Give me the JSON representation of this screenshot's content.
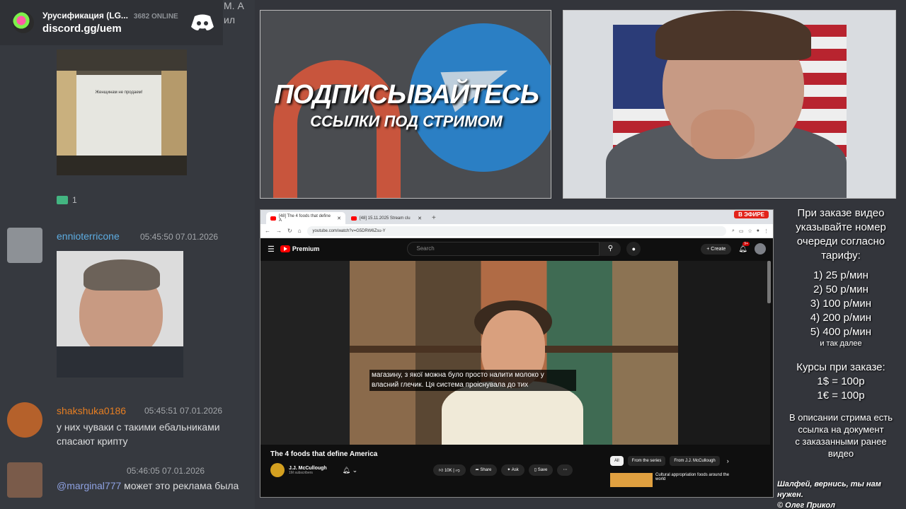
{
  "discord_widget": {
    "server_name": "Урусификация (LG...",
    "online": "3682 ONLINE",
    "invite": "discord.gg/uem"
  },
  "clipped_text": {
    "line1": "М. А",
    "line2": "ил"
  },
  "chat": {
    "attachment1_sign": "Женщинам не продаем!",
    "reaction_count": "1",
    "messages": [
      {
        "user": "ennioterricone",
        "user_color": "#5dade2",
        "time": "05:45:50 07.01.2026",
        "text": ""
      },
      {
        "user": "shakshuka0186",
        "user_color": "#e67e22",
        "time": "05:45:51 07.01.2026",
        "text": "у них чуваки с такими ебальниками спасают крипту"
      },
      {
        "user": "",
        "user_color": "#2ecc71",
        "time": "05:46:05 07.01.2026",
        "mention": "@marginal777",
        "text": " может это реклама была"
      }
    ]
  },
  "promo": {
    "title": "ПОДПИСЫВАЙТЕСЬ",
    "subtitle": "ССЫЛКИ ПОД СТРИМОМ"
  },
  "browser": {
    "tabs": [
      "[48] The 4 foods that define A",
      "[48] 15.11.2025 Stream clu"
    ],
    "live_badge": "В ЭФИРЕ",
    "url": "youtube.com/watch?v=G5DRW6Zsu-Y",
    "yt": {
      "logo": "Premium",
      "search_placeholder": "Search",
      "create": "Create",
      "notif_count": "9+",
      "subtitle_line1": "магазину, з якої можна було просто налити молоко у",
      "subtitle_line2": "власний глечик. Ця система проіснувала до тих",
      "video_title": "The 4 foods that define America",
      "channel_name": "J.J. McCullough",
      "channel_subs": "1M subscribers",
      "likes": "10K",
      "share": "Share",
      "ask": "Ask",
      "save": "Save",
      "chips": [
        "All",
        "From the series",
        "From J.J. McCullough"
      ],
      "rec_title": "Cultural appropriation foods around the world"
    }
  },
  "info": {
    "intro": [
      "При заказе видео",
      "указывайте номер",
      "очереди согласно",
      "тарифу:"
    ],
    "tariffs": [
      "1) 25 р/мин",
      "2) 50 р/мин",
      "3) 100 р/мин",
      "4) 200 р/мин",
      "5) 400 р/мин"
    ],
    "tariffs_more": "и так далее",
    "rates_title": "Курсы при заказе:",
    "rates": [
      "1$ = 100р",
      "1€ = 100р"
    ],
    "desc": [
      "В описании стрима есть",
      "ссылка на документ",
      "с заказанными ранее",
      "видео"
    ]
  },
  "credit": {
    "line1": "Шалфей, вернись, ты нам нужен.",
    "line2": "© Олег Прикол"
  },
  "colors": {
    "accent_red": "#e2231a",
    "yt_red": "#ff0000",
    "discord_bg": "#36393f"
  },
  "icons": [
    "discord-icon",
    "hamburger-icon",
    "search-icon",
    "mic-icon",
    "bell-icon",
    "like-icon",
    "dislike-icon",
    "share-icon",
    "save-icon"
  ]
}
